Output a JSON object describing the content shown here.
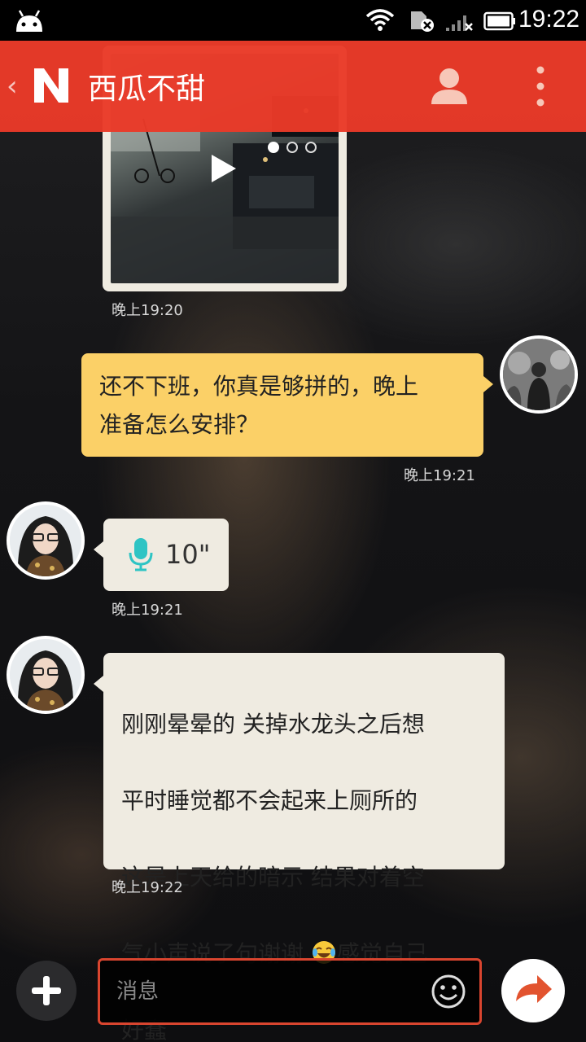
{
  "status_bar": {
    "time": "19:22",
    "icons": [
      "android-icon",
      "wifi-icon",
      "sim-icon",
      "signal-icon",
      "battery-icon"
    ]
  },
  "header": {
    "back_icon": "chevron-left-icon",
    "logo": "N",
    "contact_name": "西瓜不甜",
    "actions": [
      "profile-icon",
      "more-vertical-icon"
    ]
  },
  "colors": {
    "accent": "#e93a28",
    "outgoing_bubble": "#fbd067",
    "incoming_bubble": "#efebe1",
    "mic": "#2ec4c4"
  },
  "messages": [
    {
      "type": "video",
      "direction": "incoming",
      "time": "晚上19:20",
      "icon": "play-icon"
    },
    {
      "type": "text",
      "direction": "outgoing",
      "text": "还不下班，你真是够拼的，晚上\n准备怎么安排？",
      "time": "晚上19:21"
    },
    {
      "type": "voice",
      "direction": "incoming",
      "duration": "10\"",
      "time": "晚上19:21",
      "icon": "microphone-icon"
    },
    {
      "type": "text",
      "direction": "incoming",
      "lines": [
        "刚刚晕晕的 关掉水龙头之后想",
        "平时睡觉都不会起来上厕所的",
        "这是上天给的暗示 结果对着空"
      ],
      "line4_before": "气小声说了句谢谢 ",
      "line4_emoji": "laughing-tears-emoji",
      "line4_after": "感觉自己",
      "line5": "好蠢",
      "time": "晚上19:22"
    }
  ],
  "input_bar": {
    "add_icon": "plus-icon",
    "placeholder": "消息",
    "emoji_icon": "smiley-icon",
    "send_icon": "send-arrow-icon"
  }
}
